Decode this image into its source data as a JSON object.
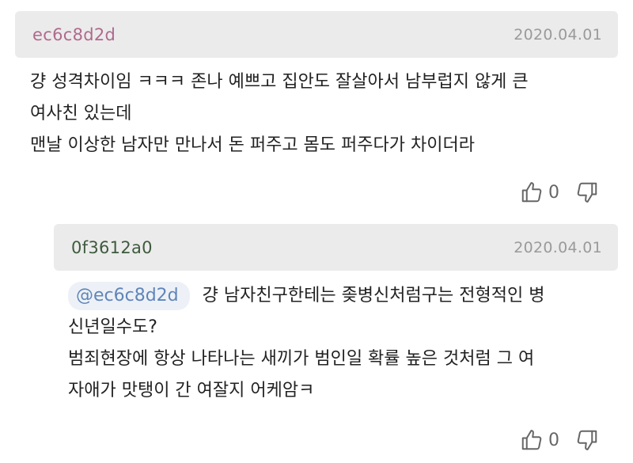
{
  "comments": [
    {
      "author": "ec6c8d2d",
      "date": "2020.04.01",
      "lines": [
        "걍 성격차이임 ㅋㅋㅋ 존나 예쁘고 집안도 잘살아서 남부럽지 않게 큰",
        "여사친 있는데",
        "맨날 이상한 남자만 만나서 돈 퍼주고 몸도 퍼주다가 차이더라"
      ],
      "likes": "0",
      "like_icon": "thumbs-up-icon",
      "dislike_icon": "thumbs-down-icon"
    },
    {
      "author": "0f3612a0",
      "date": "2020.04.01",
      "mention": "@ec6c8d2d",
      "lines": [
        "걍 남자친구한테는 좆병신처럼구는 전형적인 병",
        "신년일수도?",
        "범죄현장에 항상 나타나는 새끼가 범인일 확률 높은 것처럼 그 여",
        "자애가 맛탱이 간 여잘지 어케암ㅋ"
      ],
      "likes": "0",
      "like_icon": "thumbs-up-icon",
      "dislike_icon": "thumbs-down-icon"
    }
  ],
  "colors": {
    "header_bg": "#ebebeb",
    "author1": "#b06a8c",
    "author2": "#3e5a3e",
    "mention_bg": "#edf1f7",
    "mention_text": "#5f85b8",
    "date": "#9a9a9a"
  }
}
